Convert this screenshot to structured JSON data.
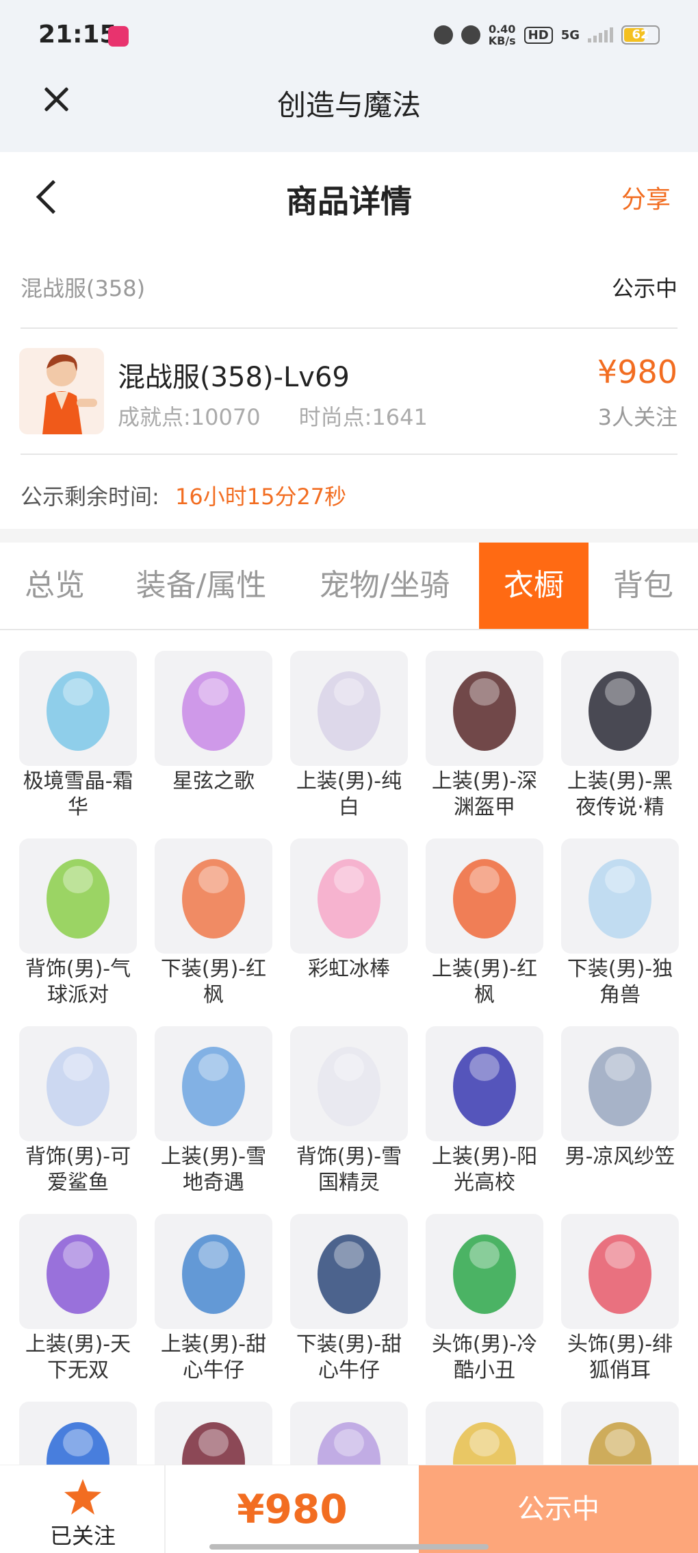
{
  "status_bar": {
    "time": "21:15",
    "speed_value": "0.40",
    "speed_unit": "KB/s",
    "hd_label": "HD",
    "signal_label": "5G",
    "battery_level": "62",
    "icons": [
      "alarm-icon",
      "mute-icon",
      "hd-icon",
      "signal-icon",
      "battery-icon"
    ]
  },
  "app": {
    "title": "创造与魔法"
  },
  "page": {
    "title": "商品详情",
    "share_label": "分享"
  },
  "listing": {
    "server": "混战服(358)",
    "status": "公示中",
    "char_name": "混战服(358)-Lv69",
    "achievement": "成就点:10070",
    "fashion": "时尚点:1641",
    "price": "¥980",
    "followers": "3人关注",
    "remain_label": "公示剩余时间:",
    "remain_value": "16小时15分27秒"
  },
  "tabs": [
    {
      "label": "总览",
      "active": false
    },
    {
      "label": "装备/属性",
      "active": false
    },
    {
      "label": "宠物/坐骑",
      "active": false
    },
    {
      "label": "衣橱",
      "active": true
    },
    {
      "label": "背包",
      "active": false
    }
  ],
  "items": [
    {
      "label": "极境雪晶-霜华",
      "color": "#7ec8e8"
    },
    {
      "label": "星弦之歌",
      "color": "#c98ae6"
    },
    {
      "label": "上装(男)-纯白",
      "color": "#d9d4e8"
    },
    {
      "label": "上装(男)-深渊盔甲",
      "color": "#5a2a2a"
    },
    {
      "label": "上装(男)-黑夜传说·精",
      "color": "#2b2b36"
    },
    {
      "label": "背饰(男)-气球派对",
      "color": "#8ccf4a"
    },
    {
      "label": "下装(男)-红枫",
      "color": "#f0794a"
    },
    {
      "label": "彩虹冰棒",
      "color": "#f7a8c8"
    },
    {
      "label": "上装(男)-红枫",
      "color": "#f06a3a"
    },
    {
      "label": "下装(男)-独角兽",
      "color": "#b8d8f0"
    },
    {
      "label": "背饰(男)-可爱鲨鱼",
      "color": "#c6d4f0"
    },
    {
      "label": "上装(男)-雪地奇遇",
      "color": "#6fa6e0"
    },
    {
      "label": "背饰(男)-雪国精灵",
      "color": "#e8e8ee"
    },
    {
      "label": "上装(男)-阳光高校",
      "color": "#3a3ab0"
    },
    {
      "label": "男-凉风纱笠",
      "color": "#9aa8c0"
    },
    {
      "label": "上装(男)-天下无双",
      "color": "#8a5ad6"
    },
    {
      "label": "上装(男)-甜心牛仔",
      "color": "#4a8ad0"
    },
    {
      "label": "下装(男)-甜心牛仔",
      "color": "#2f4a7a"
    },
    {
      "label": "头饰(男)-冷酷小丑",
      "color": "#2ea84a"
    },
    {
      "label": "头饰(男)-绯狐俏耳",
      "color": "#e85a6a"
    },
    {
      "label": "",
      "color": "#2a6ad8"
    },
    {
      "label": "",
      "color": "#7a2a3a"
    },
    {
      "label": "",
      "color": "#b8a0e0"
    },
    {
      "label": "",
      "color": "#e8c04a"
    },
    {
      "label": "",
      "color": "#c8a040"
    }
  ],
  "bottom": {
    "follow_label": "已关注",
    "price": "¥980",
    "status": "公示中"
  },
  "colors": {
    "accent": "#ff6a13",
    "price": "#f26d21",
    "status_button": "#fda67a"
  }
}
